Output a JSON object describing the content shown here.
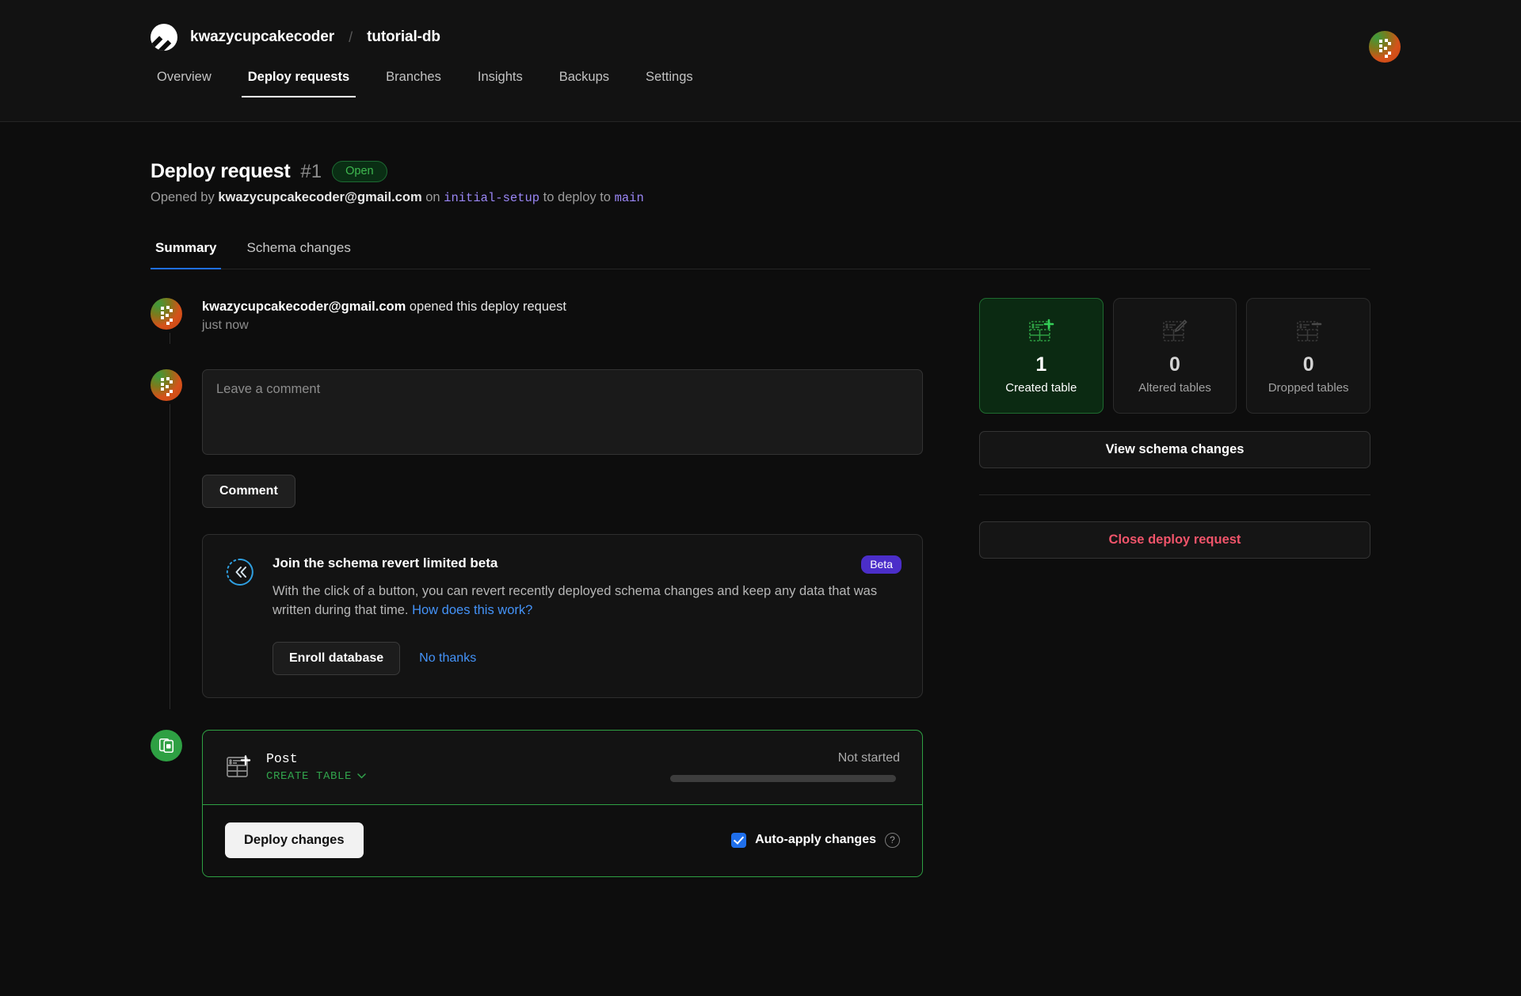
{
  "header": {
    "logo_icon": "planetscale-logo-icon",
    "org": "kwazycupcakecoder",
    "separator": "/",
    "database": "tutorial-db",
    "avatar_icon": "user-avatar",
    "nav": [
      {
        "label": "Overview",
        "active": false
      },
      {
        "label": "Deploy requests",
        "active": true
      },
      {
        "label": "Branches",
        "active": false
      },
      {
        "label": "Insights",
        "active": false
      },
      {
        "label": "Backups",
        "active": false
      },
      {
        "label": "Settings",
        "active": false
      }
    ]
  },
  "deploy_request": {
    "title": "Deploy request",
    "number": "#1",
    "status": "Open",
    "status_color": "#3fb950",
    "sub_prefix": "Opened by",
    "author": "kwazycupcakecoder@gmail.com",
    "sub_on": "on",
    "source_branch": "initial-setup",
    "sub_to": "to deploy to",
    "target_branch": "main"
  },
  "tabs": [
    {
      "label": "Summary",
      "active": true
    },
    {
      "label": "Schema changes",
      "active": false
    }
  ],
  "timeline": {
    "event_author": "kwazycupcakecoder@gmail.com",
    "event_action": "opened this deploy request",
    "event_time": "just now"
  },
  "comment": {
    "placeholder": "Leave a comment",
    "value": "",
    "submit_label": "Comment"
  },
  "beta_card": {
    "icon": "schema-revert-icon",
    "title": "Join the schema revert limited beta",
    "tag": "Beta",
    "tag_color": "#4b2ec9",
    "description": "With the click of a button, you can revert recently deployed schema changes and keep any data that was written during that time.",
    "link_text": "How does this work?",
    "primary_label": "Enroll database",
    "secondary_label": "No thanks"
  },
  "deploy_card": {
    "avatar_icon": "deploy-database-icon",
    "table_icon": "create-table-icon",
    "table_name": "Post",
    "operation": "CREATE TABLE",
    "operation_chevron": "chevron-down-icon",
    "status": "Not started",
    "progress_percent": 0,
    "deploy_label": "Deploy changes",
    "auto_apply_label": "Auto-apply changes",
    "auto_apply_checked": true,
    "help_icon": "help-circle-icon"
  },
  "sidebar": {
    "stats": [
      {
        "icon": "table-plus-icon",
        "value": "1",
        "label": "Created table",
        "highlight": true
      },
      {
        "icon": "table-edit-icon",
        "value": "0",
        "label": "Altered tables",
        "highlight": false
      },
      {
        "icon": "table-minus-icon",
        "value": "0",
        "label": "Dropped tables",
        "highlight": false
      }
    ],
    "view_schema_label": "View schema changes",
    "close_label": "Close deploy request",
    "close_color": "#f0546a"
  }
}
